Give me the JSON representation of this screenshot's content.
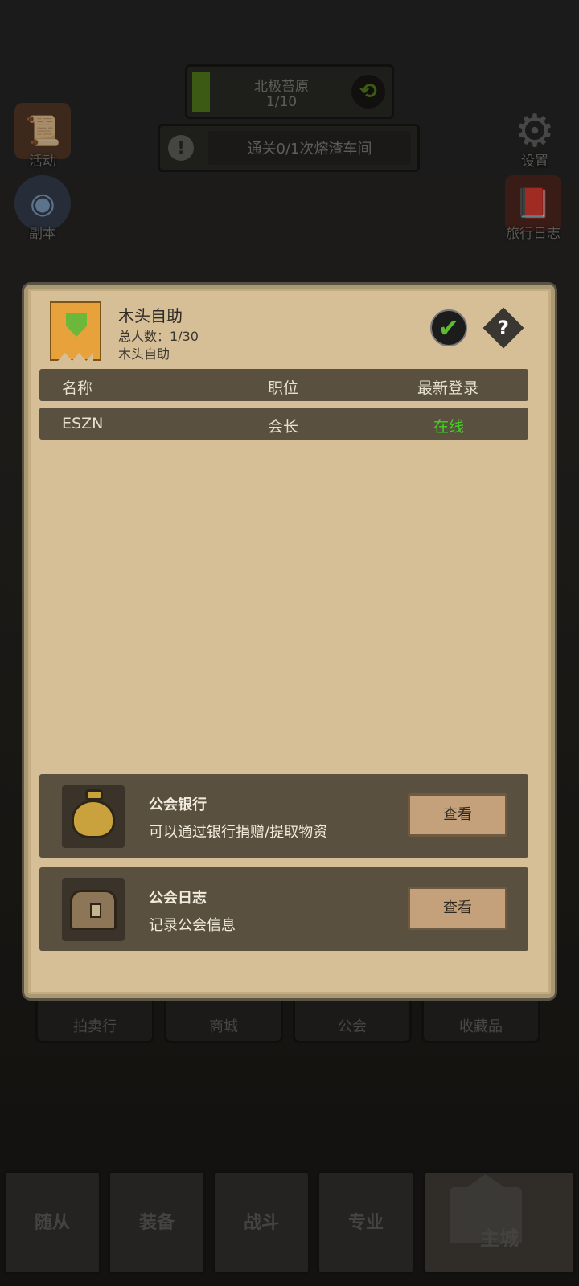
{
  "hud": {
    "zone_title": "北极苔原",
    "zone_progress": "1/10",
    "quest_text": "通关0/1次熔渣车间"
  },
  "side_buttons": {
    "activity": "活动",
    "dungeon": "副本",
    "settings": "设置",
    "travel_log": "旅行日志"
  },
  "guild": {
    "name": "木头自助",
    "member_count": "总人数：1/30",
    "description": "木头自助",
    "columns": [
      "名称",
      "职位",
      "最新登录"
    ],
    "members": [
      {
        "name": "ESZN",
        "role": "会长",
        "status": "在线"
      }
    ],
    "bank": {
      "title": "公会银行",
      "desc": "可以通过银行捐赠/提取物资",
      "button": "查看"
    },
    "log": {
      "title": "公会日志",
      "desc": "记录公会信息",
      "button": "查看"
    }
  },
  "features": [
    "拍卖行",
    "商城",
    "公会",
    "收藏品"
  ],
  "nav": [
    "随从",
    "装备",
    "战斗",
    "专业",
    "主城"
  ],
  "colors": {
    "online": "#3fd41f",
    "panel": "#d6bf97",
    "row": "#59503f"
  }
}
